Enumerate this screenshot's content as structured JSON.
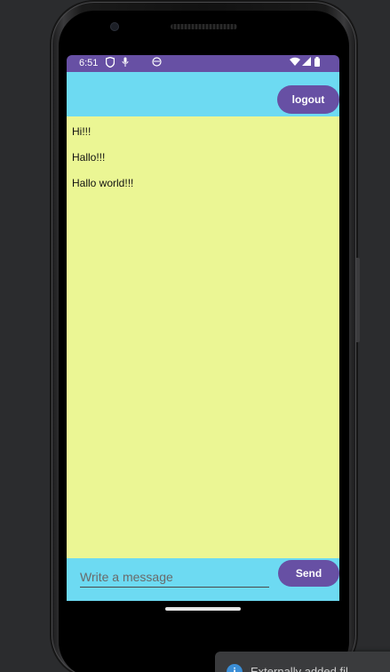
{
  "status_bar": {
    "time": "6:51",
    "left_icons": [
      "shield-icon",
      "mic-icon",
      "face-icon"
    ],
    "right_icons": [
      "wifi-icon",
      "signal-icon",
      "battery-icon"
    ]
  },
  "app_bar": {
    "logout_label": "logout"
  },
  "messages": [
    {
      "text": "Hi!!!"
    },
    {
      "text": "Hallo!!!"
    },
    {
      "text": "Hallo world!!!"
    }
  ],
  "composer": {
    "placeholder": "Write a message",
    "value": "",
    "send_label": "Send"
  },
  "toast": {
    "icon": "info-icon",
    "text": "Externally added fil"
  },
  "colors": {
    "status_bar": "#6750a4",
    "app_bar": "#6ddaf2",
    "message_area": "#ebf694",
    "button": "#6750a4"
  }
}
